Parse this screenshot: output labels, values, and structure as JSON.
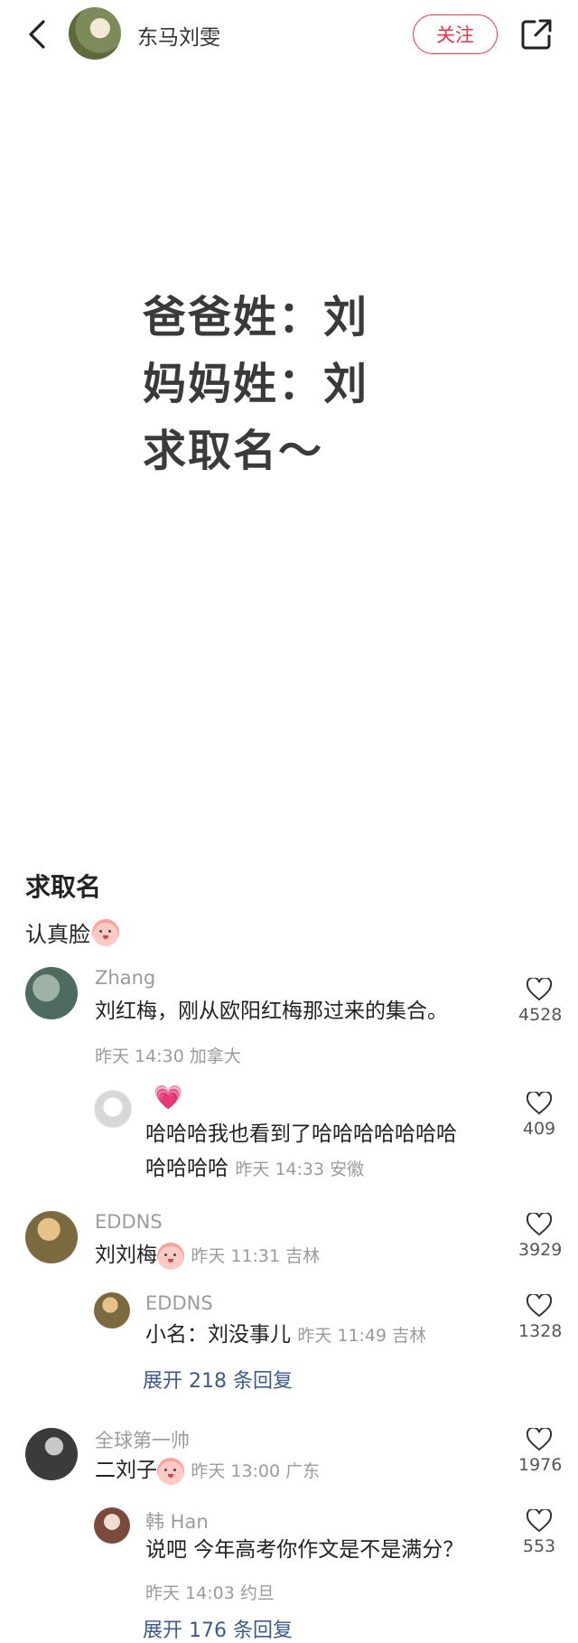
{
  "header": {
    "author_name": "东马刘雯",
    "follow_label": "关注"
  },
  "note": {
    "image_lines": [
      "爸爸姓：刘",
      "妈妈姓：刘",
      "求取名～"
    ],
    "title": "求取名",
    "desc": "认真脸"
  },
  "comments": [
    {
      "name": "Zhang",
      "text": "刘红梅，刚从欧阳红梅那过来的集合。",
      "meta": "昨天 14:30 加拿大",
      "likes": "4528",
      "replies": [
        {
          "name": "",
          "line1": "哈哈哈我也看到了哈哈哈哈哈哈哈",
          "line2": "哈哈哈哈",
          "meta": "昨天 14:33 安徽",
          "likes": "409"
        }
      ]
    },
    {
      "name": "EDDNS",
      "text": "刘刘梅",
      "meta": "昨天 11:31 吉林",
      "likes": "3929",
      "replies": [
        {
          "name": "EDDNS",
          "text": "小名：刘没事儿",
          "meta": "昨天 11:49 吉林",
          "likes": "1328"
        }
      ],
      "expand_label": "展开 218 条回复"
    },
    {
      "name": "全球第一帅",
      "text": "二刘子",
      "meta": "昨天 13:00 广东",
      "likes": "1976",
      "replies": [
        {
          "name": "韩 Han",
          "text": "说吧 今年高考你作文是不是满分？",
          "meta": "昨天 14:03 约旦",
          "likes": "553"
        }
      ],
      "expand_label": "展开 176 条回复"
    }
  ],
  "colors": {
    "accent": "#e8334a",
    "link": "#3c5b8a",
    "meta": "#9b9b9b"
  }
}
